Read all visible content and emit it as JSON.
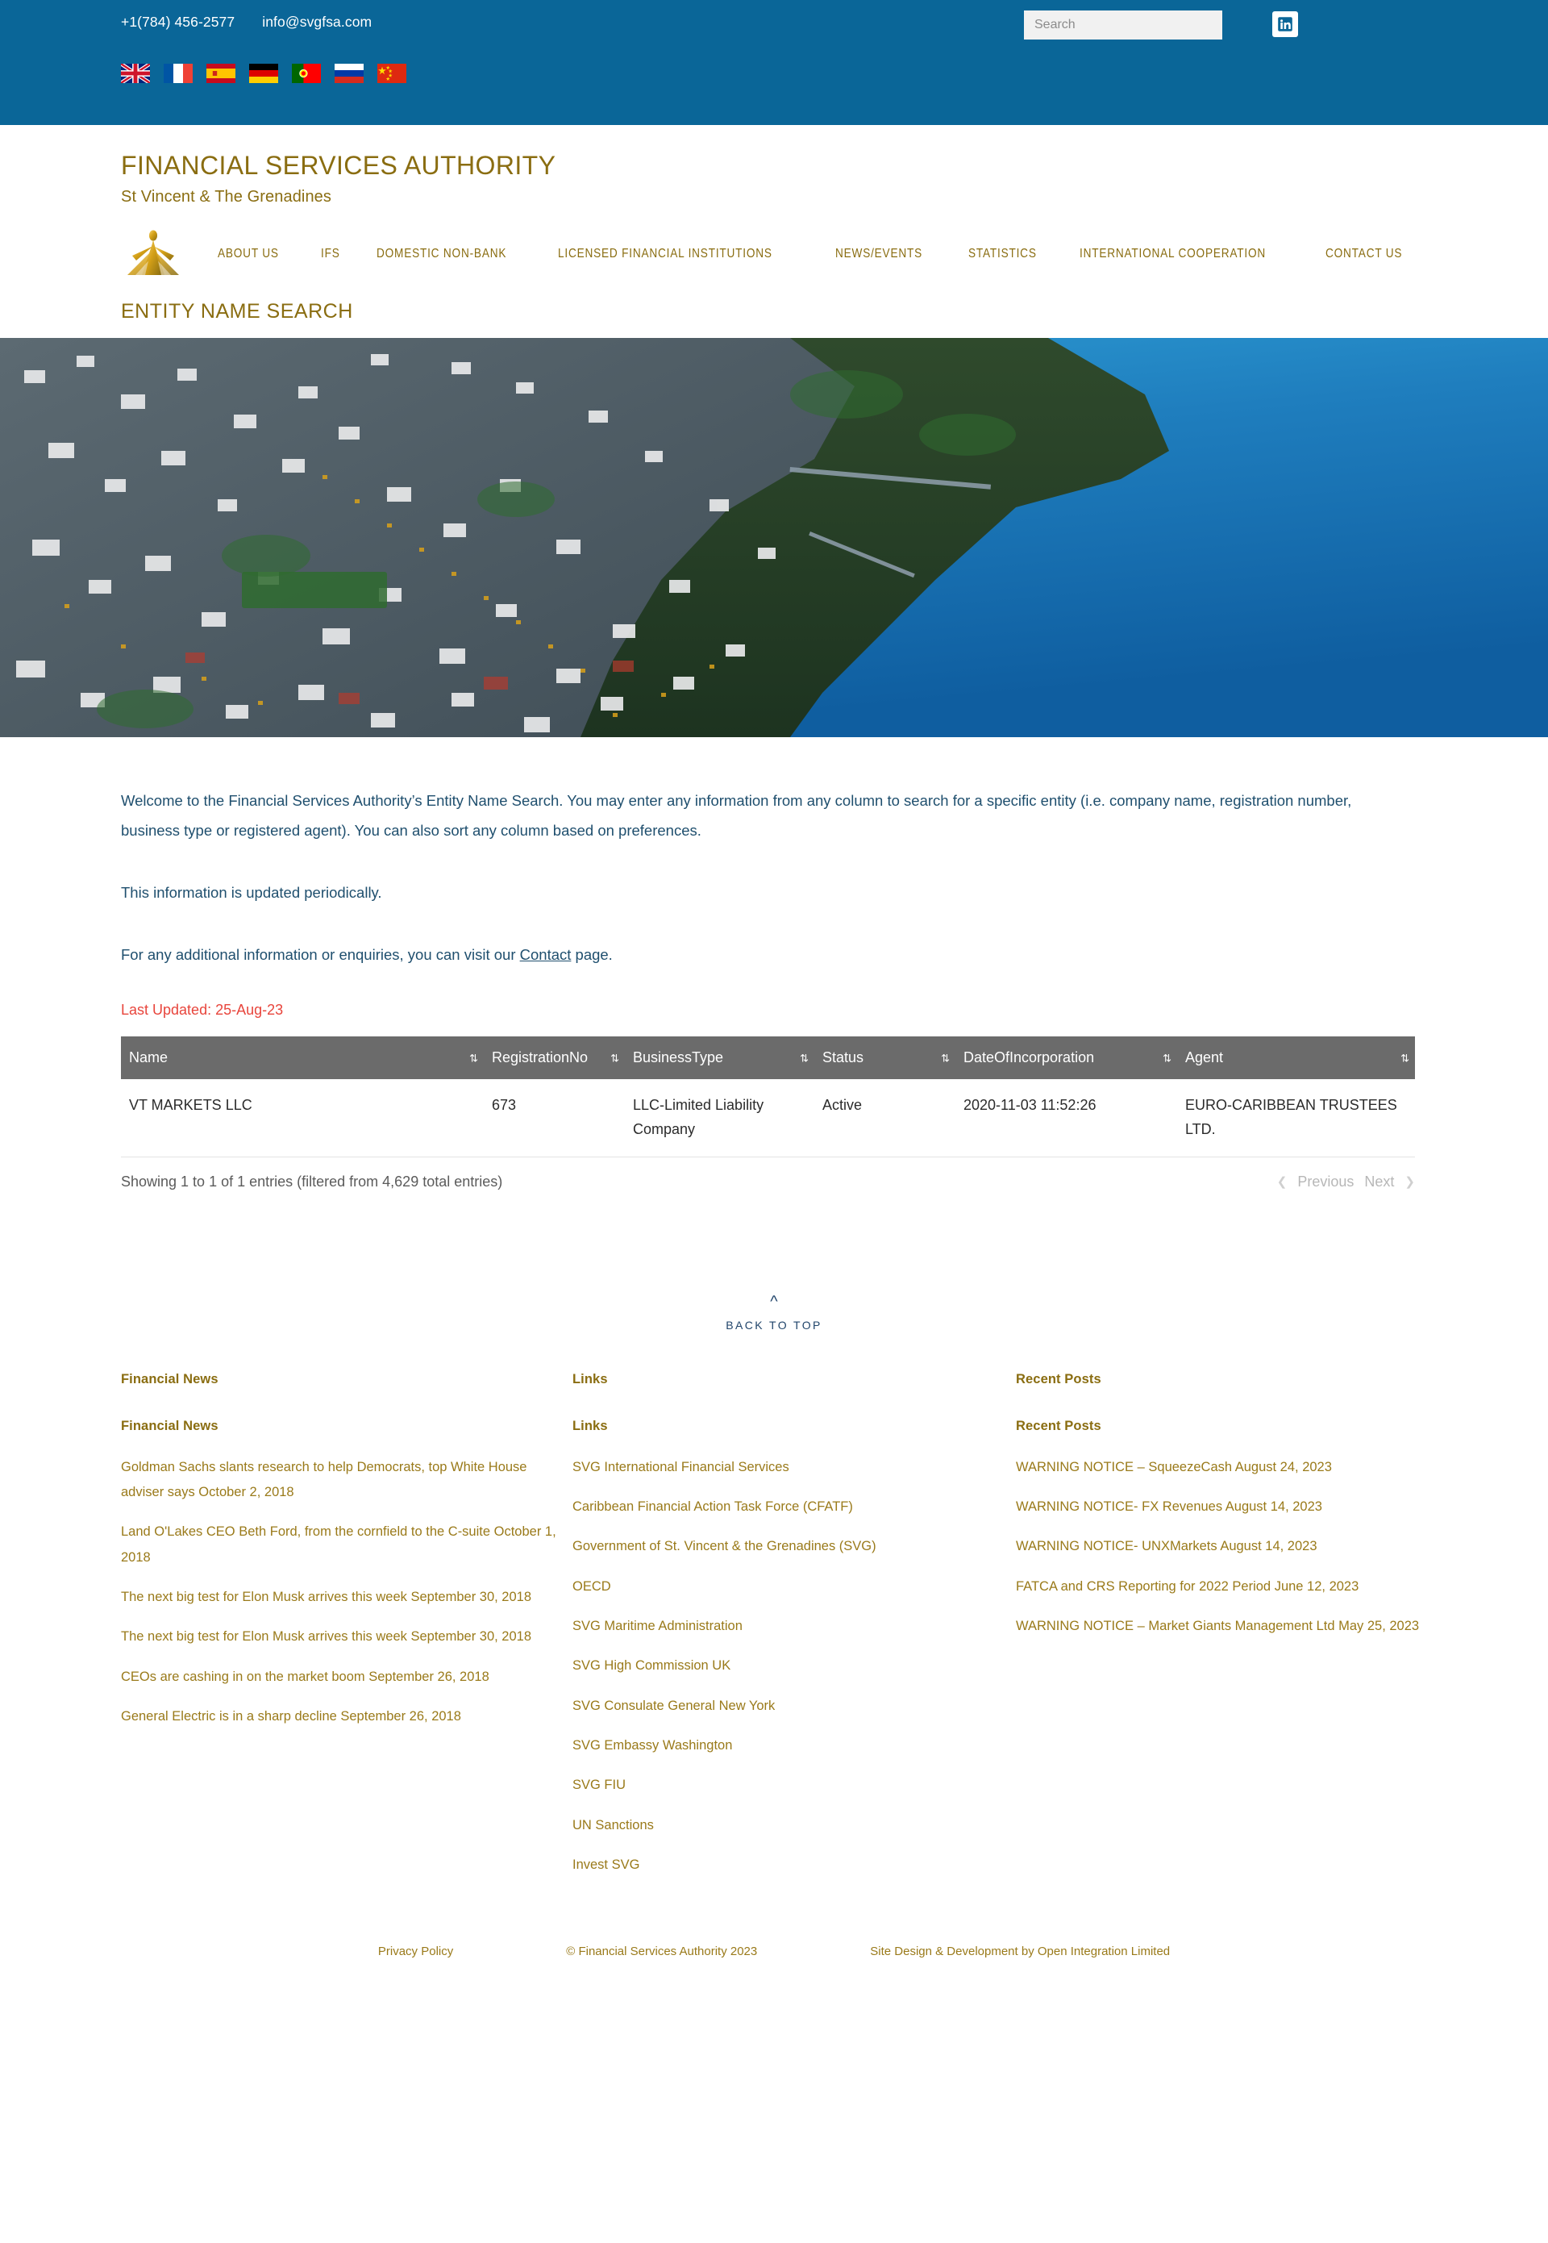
{
  "topbar": {
    "phone": "+1(784) 456-2577",
    "email": "info@svgfsa.com",
    "search_placeholder": "Search",
    "search_value": "",
    "linkedin_label": "in",
    "flags": [
      {
        "name": "flag-united-kingdom",
        "title": "English"
      },
      {
        "name": "flag-france",
        "title": "Français"
      },
      {
        "name": "flag-spain",
        "title": "Español"
      },
      {
        "name": "flag-germany",
        "title": "Deutsch"
      },
      {
        "name": "flag-portugal",
        "title": "Português"
      },
      {
        "name": "flag-russia",
        "title": "Русский"
      },
      {
        "name": "flag-china",
        "title": "中文"
      }
    ]
  },
  "header": {
    "title": "FINANCIAL SERVICES AUTHORITY",
    "subtitle": "St Vincent & The Grenadines",
    "page_title": "ENTITY NAME SEARCH",
    "nav": [
      "ABOUT US",
      "IFS",
      "DOMESTIC NON-BANK",
      "LICENSED FINANCIAL INSTITUTIONS",
      "NEWS/EVENTS",
      "STATISTICS",
      "INTERNATIONAL COOPERATION",
      "CONTACT US"
    ]
  },
  "content": {
    "paragraph1": "Welcome to the Financial Services Authority’s Entity Name Search. You may enter any information from any column to search for a specific entity (i.e. company name, registration number, business type or registered agent). You can also sort any column based on preferences.",
    "paragraph2": "This information is updated periodically.",
    "paragraph3_before": "For any additional information or enquiries, you can visit our ",
    "paragraph3_link": "Contact",
    "paragraph3_after": " page.",
    "last_updated": "Last Updated:  25-Aug-23"
  },
  "table": {
    "columns": [
      "Name",
      "RegistrationNo",
      "BusinessType",
      "Status",
      "DateOfIncorporation",
      "Agent"
    ],
    "rows": [
      {
        "name": "VT MARKETS LLC",
        "registration_no": "673",
        "business_type": "LLC-Limited Liability Company",
        "status": "Active",
        "date_of_incorporation": "2020-11-03 11:52:26",
        "agent": "EURO-CARIBBEAN TRUSTEES LTD."
      }
    ],
    "info": "Showing 1 to 1 of 1 entries (filtered from 4,629 total entries)",
    "previous_label": "Previous",
    "next_label": "Next"
  },
  "back_to_top": {
    "label": "BACK TO TOP"
  },
  "footer": {
    "financial_news": {
      "heading": "Financial News",
      "items": [
        "Goldman Sachs slants research to help Democrats, top White House adviser says October 2, 2018",
        "Land O'Lakes CEO Beth Ford, from the cornfield to the C-suite October 1, 2018",
        "The next big test for Elon Musk arrives this week September 30, 2018",
        "The next big test for Elon Musk arrives this week September 30, 2018",
        "CEOs are cashing in on the market boom September 26, 2018",
        "General Electric is in a sharp decline September 26, 2018"
      ]
    },
    "links": {
      "heading": "Links",
      "items": [
        "SVG International Financial Services",
        "Caribbean Financial Action Task Force (CFATF)",
        "Government of St. Vincent & the Grenadines (SVG)",
        "OECD",
        "SVG Maritime Administration",
        "SVG High Commission UK",
        "SVG Consulate General New York",
        "SVG Embassy Washington",
        "SVG FIU",
        "UN Sanctions",
        "Invest SVG"
      ]
    },
    "recent_posts": {
      "heading": "Recent Posts",
      "items": [
        "WARNING NOTICE – SqueezeCash August 24, 2023",
        "WARNING NOTICE- FX Revenues August 14, 2023",
        "WARNING NOTICE- UNXMarkets August 14, 2023",
        "FATCA and CRS Reporting for 2022 Period June 12, 2023",
        "WARNING NOTICE – Market Giants Management Ltd May 25, 2023"
      ]
    },
    "bottom": {
      "privacy": "Privacy Policy",
      "copyright": "© Financial Services Authority 2023",
      "credit": "Site Design & Development by Open Integration Limited"
    }
  },
  "colors": {
    "topbar_blue": "#0a6698",
    "gold": "#8a6d11",
    "link_gold": "#9a7a1a",
    "body_text_blue": "#1f4f6e",
    "alert_red": "#e8453c",
    "table_header_gray": "#6b6b6b"
  }
}
